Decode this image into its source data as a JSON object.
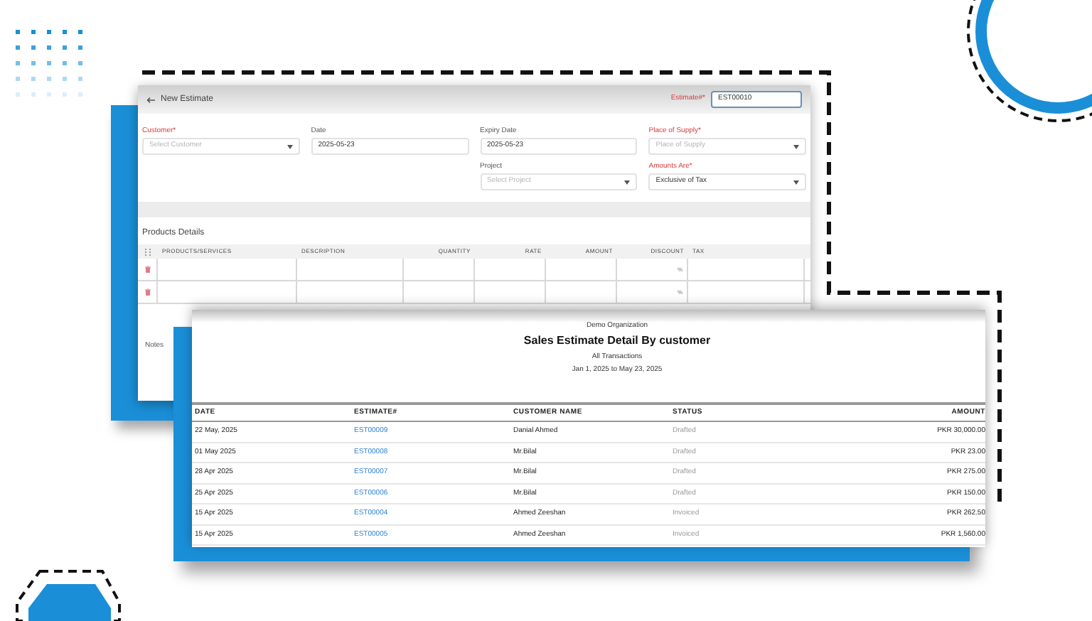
{
  "form": {
    "title": "New Estimate",
    "estimate_number": {
      "label": "Estimate#*",
      "required": true,
      "value": "EST00010"
    },
    "field_rows": [
      [
        {
          "label": "Customer*",
          "required": true,
          "kind": "select",
          "placeholder": "Select Customer"
        },
        {
          "label": "Date",
          "required": false,
          "kind": "text",
          "value": "2025-05-23"
        },
        {
          "label": "Expiry Date",
          "required": false,
          "kind": "text",
          "value": "2025-05-23"
        },
        {
          "label": "Place of Supply*",
          "required": true,
          "kind": "select",
          "placeholder": "Place of Supply"
        }
      ],
      [
        {
          "label": "Project",
          "required": false,
          "kind": "select",
          "placeholder": "Select Project"
        },
        {
          "label": "Amounts Are*",
          "required": true,
          "kind": "select",
          "value": "Exclusive of Tax"
        }
      ]
    ],
    "products": {
      "title": "Products Details",
      "columns": [
        "PRODUCTS/SERVICES",
        "DESCRIPTION",
        "QUANTITY",
        "RATE",
        "AMOUNT",
        "DISCOUNT",
        "TAX"
      ],
      "rows": [
        {
          "discount": "%"
        },
        {
          "discount": "%"
        }
      ]
    },
    "notes_label": "Notes"
  },
  "report": {
    "organization": "Demo Organization",
    "title": "Sales Estimate Detail By customer",
    "subtitle": "All Transactions",
    "date_range": "Jan 1, 2025 to May 23, 2025",
    "columns": [
      "DATE",
      "ESTIMATE#",
      "CUSTOMER NAME",
      "STATUS",
      "AMOUNT"
    ],
    "rows": [
      {
        "date": "22 May, 2025",
        "estimate": "EST00009",
        "customer": "Danial Ahmed",
        "status": "Drafted",
        "amount": "PKR 30,000.00"
      },
      {
        "date": "01 May 2025",
        "estimate": "EST00008",
        "customer": "Mr.Bilal",
        "status": "Drafted",
        "amount": "PKR 23.00"
      },
      {
        "date": "28 Apr 2025",
        "estimate": "EST00007",
        "customer": "Mr.Bilal",
        "status": "Drafted",
        "amount": "PKR 275.00"
      },
      {
        "date": "25 Apr 2025",
        "estimate": "EST00006",
        "customer": "Mr.Bilal",
        "status": "Drafted",
        "amount": "PKR 150.00"
      },
      {
        "date": "15 Apr 2025",
        "estimate": "EST00004",
        "customer": "Ahmed Zeeshan",
        "status": "Invoiced",
        "amount": "PKR 262.50"
      },
      {
        "date": "15 Apr 2025",
        "estimate": "EST00005",
        "customer": "Ahmed Zeeshan",
        "status": "Invoiced",
        "amount": "PKR 1,560.00"
      }
    ]
  }
}
